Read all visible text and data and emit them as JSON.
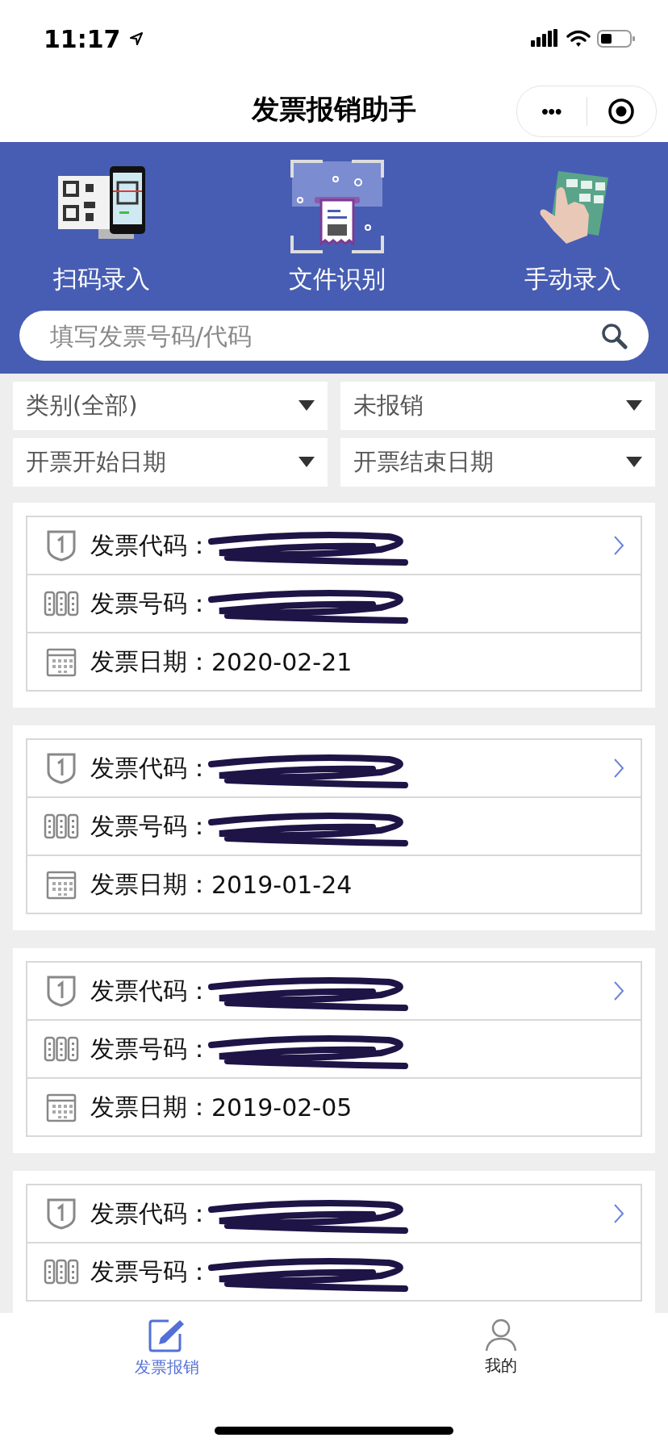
{
  "status_bar": {
    "time": "11:17"
  },
  "nav": {
    "title": "发票报销助手",
    "more": "•••"
  },
  "actions": [
    {
      "kind": "scan",
      "label": "扫码录入"
    },
    {
      "kind": "file",
      "label": "文件识别"
    },
    {
      "kind": "manual",
      "label": "手动录入"
    }
  ],
  "search": {
    "placeholder": "填写发票号码/代码"
  },
  "filters": [
    {
      "label": "类别(全部)"
    },
    {
      "label": "未报销"
    },
    {
      "label": "开票开始日期"
    },
    {
      "label": "开票结束日期"
    }
  ],
  "invoices": [
    {
      "fields": [
        {
          "kind": "code",
          "label": "发票代码：",
          "redacted": true
        },
        {
          "kind": "number",
          "label": "发票号码：",
          "redacted": true
        },
        {
          "kind": "date",
          "label": "发票日期：",
          "value": "2020-02-21"
        }
      ]
    },
    {
      "fields": [
        {
          "kind": "code",
          "label": "发票代码：",
          "redacted": true
        },
        {
          "kind": "number",
          "label": "发票号码：",
          "redacted": true
        },
        {
          "kind": "date",
          "label": "发票日期：",
          "value": "2019-01-24"
        }
      ]
    },
    {
      "fields": [
        {
          "kind": "code",
          "label": "发票代码：",
          "redacted": true
        },
        {
          "kind": "number",
          "label": "发票号码：",
          "redacted": true
        },
        {
          "kind": "date",
          "label": "发票日期：",
          "value": "2019-02-05"
        }
      ]
    },
    {
      "fields": [
        {
          "kind": "code",
          "label": "发票代码：",
          "redacted": true
        },
        {
          "kind": "number",
          "label": "发票号码：",
          "redacted": true
        }
      ]
    }
  ],
  "tab_bar": [
    {
      "kind": "edit",
      "label": "发票报销",
      "selected": true
    },
    {
      "kind": "profile",
      "label": "我的",
      "selected": false
    }
  ]
}
